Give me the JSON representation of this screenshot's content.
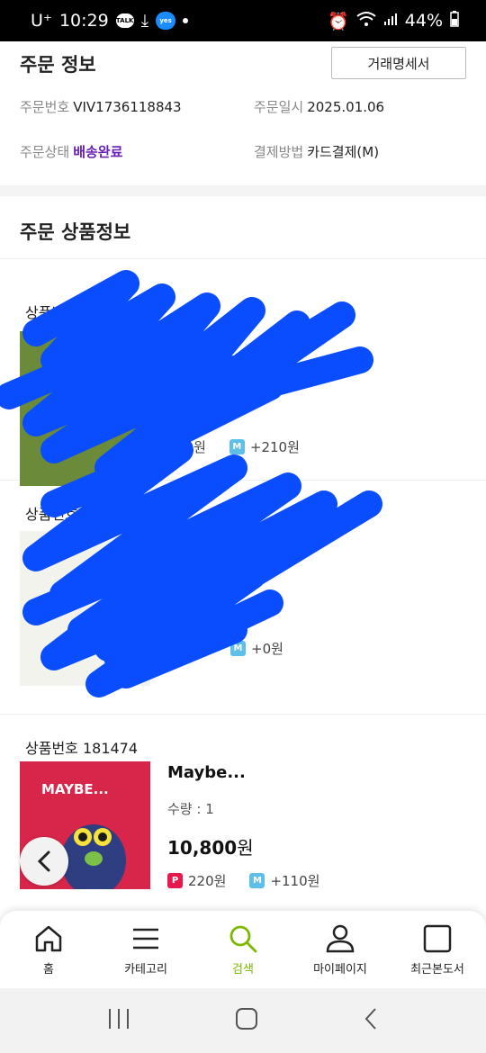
{
  "status_bar": {
    "carrier": "U⁺",
    "time": "10:29",
    "talk_label": "TALK",
    "yes_label": "yes",
    "battery": "44%"
  },
  "order_info": {
    "title": "주문 정보",
    "receipt_button": "거래명세서",
    "order_no_label": "주문번호",
    "order_no": "VIV1736118843",
    "order_date_label": "주문일시",
    "order_date": "2025.01.06",
    "status_label": "주문상태",
    "status": "배송완료",
    "payment_label": "결제방법",
    "payment": "카드결제(M)"
  },
  "products_title": "주문 상품정보",
  "products": [
    {
      "no_label": "상품번호 1",
      "price_points": "20원",
      "m_points": "+210원"
    },
    {
      "no_label": "상품번호",
      "name": "Li...r...",
      "qty": "수...",
      "price": "...0원",
      "m_points": "+0원"
    },
    {
      "no_label": "상품번호 181474",
      "name": "Maybe...",
      "qty": "수량 : 1",
      "price_num": "10,800",
      "price_unit": "원",
      "p_points": "220원",
      "m_points": "+110원",
      "cover_title": "MAYBE..."
    }
  ],
  "badges": {
    "p": "P",
    "m": "M"
  },
  "bottom_nav": [
    {
      "label": "홈",
      "icon": "home-icon"
    },
    {
      "label": "카테고리",
      "icon": "menu-icon"
    },
    {
      "label": "검색",
      "icon": "search-icon",
      "active": true
    },
    {
      "label": "마이페이지",
      "icon": "person-icon"
    },
    {
      "label": "최근본도서",
      "icon": "square-icon"
    }
  ],
  "colors": {
    "accent_green": "#7cb800",
    "status_purple": "#6a1fb5",
    "scribble_blue": "#0a4dff",
    "p_badge": "#e5194b",
    "m_badge": "#5ec0e8"
  }
}
